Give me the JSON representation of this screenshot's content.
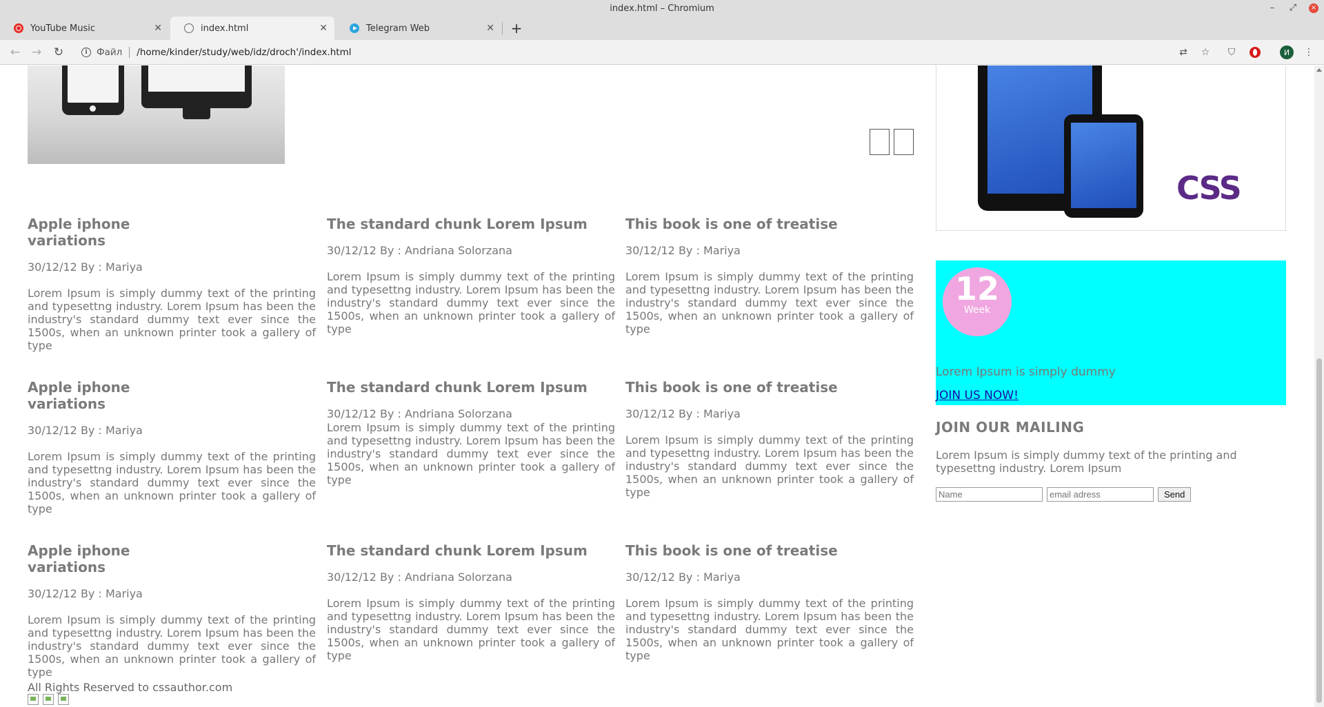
{
  "window": {
    "title": "index.html – Chromium",
    "controls": [
      "–",
      "⤢",
      "×"
    ]
  },
  "tabs": [
    {
      "label": "YouTube Music",
      "icon": "youtube-music-icon",
      "active": false
    },
    {
      "label": "index.html",
      "icon": "globe-icon",
      "active": true
    },
    {
      "label": "Telegram Web",
      "icon": "telegram-icon",
      "active": false
    }
  ],
  "omnibox": {
    "scheme_label": "Файл",
    "url": "/home/kinder/study/web/idz/droch'/index.html"
  },
  "profile": {
    "initial": "И"
  },
  "page": {
    "columns": [
      [
        {
          "title": "Apple iphone variations",
          "meta": "30/12/12 By : Mariya",
          "body": "Lorem Ipsum is simply dummy text of the printing and typesettng industry. Lorem Ipsum has been the industry's standard dummy text ever since the 1500s, when an unknown printer took a gallery of type"
        },
        {
          "title": "Apple iphone variations",
          "meta": "30/12/12 By : Mariya",
          "body": "Lorem Ipsum is simply dummy text of the printing and typesettng industry. Lorem Ipsum has been the industry's standard dummy text ever since the 1500s, when an unknown printer took a gallery of type"
        },
        {
          "title": "Apple iphone variations",
          "meta": "30/12/12 By : Mariya",
          "body": "Lorem Ipsum is simply dummy text of the printing and typesettng industry. Lorem Ipsum has been the industry's standard dummy text ever since the 1500s, when an unknown printer took a gallery of type"
        }
      ],
      [
        {
          "title": "The standard chunk Lorem Ipsum",
          "meta": "30/12/12 By : Andriana Solorzana",
          "body": "Lorem Ipsum is simply dummy text of the printing and typesettng industry. Lorem Ipsum has been the industry's standard dummy text ever since the 1500s, when an unknown printer took a gallery of type"
        },
        {
          "title": "The standard chunk Lorem Ipsum",
          "meta": "30/12/12 By : Andriana Solorzana",
          "body": "Lorem Ipsum is simply dummy text of the printing and typesettng industry. Lorem Ipsum has been the industry's standard dummy text ever since the 1500s, when an unknown printer took a gallery of type"
        },
        {
          "title": "The standard chunk Lorem Ipsum",
          "meta": "30/12/12 By : Andriana Solorzana",
          "body": "Lorem Ipsum is simply dummy text of the printing and typesettng industry. Lorem Ipsum has been the industry's standard dummy text ever since the 1500s, when an unknown printer took a gallery of type"
        }
      ],
      [
        {
          "title": "This book is one of treatise",
          "meta": "30/12/12 By : Mariya",
          "body": "Lorem Ipsum is simply dummy text of the printing and typesettng industry. Lorem Ipsum has been the industry's standard dummy text ever since the 1500s, when an unknown printer took a gallery of type"
        },
        {
          "title": "This book is one of treatise",
          "meta": "30/12/12 By : Mariya",
          "body": "Lorem Ipsum is simply dummy text of the printing and typesettng industry. Lorem Ipsum has been the industry's standard dummy text ever since the 1500s, when an unknown printer took a gallery of type"
        },
        {
          "title": "This book is one of treatise",
          "meta": "30/12/12 By : Mariya",
          "body": "Lorem Ipsum is simply dummy text of the printing and typesettng industry. Lorem Ipsum has been the industry's standard dummy text ever since the 1500s, when an unknown printer took a gallery of type"
        }
      ]
    ],
    "footer": {
      "text": "All Rights Reserved to cssauthor.com"
    }
  },
  "sidebar": {
    "css_logo_text": "CSS",
    "promo": {
      "number": "12",
      "unit": "Week",
      "text": "Lorem Ipsum is simply dummy",
      "link": "JOIN US NOW!",
      "bg_color": "#00ffff",
      "badge_color": "#f0a6e0"
    },
    "mailing": {
      "title": "JOIN OUR MAILING",
      "text": "Lorem Ipsum is simply dummy text of the printing and typesettng industry. Lorem Ipsum",
      "name_placeholder": "Name",
      "email_placeholder": "email adress",
      "send_label": "Send"
    }
  }
}
